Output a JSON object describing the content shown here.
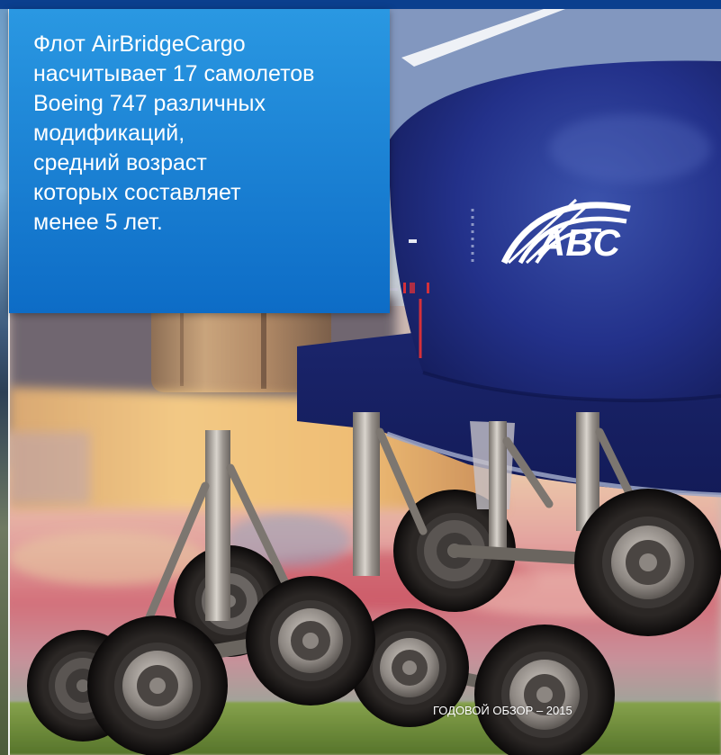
{
  "callout": {
    "lines": [
      "Флот AirBridgeCargo",
      "насчитывает 17 самолетов",
      "Boeing 747 различных",
      "модификаций,",
      "средний возраст",
      "которых составляет",
      "менее 5 лет."
    ]
  },
  "photo": {
    "logo_text": "ABC"
  },
  "footer": {
    "label": "ГОДОВОЙ ОБЗОР – 2015"
  },
  "colors": {
    "top_band": "#0b3f8e",
    "callout_top": "#2a98e2",
    "callout_bottom": "#0d6cc6",
    "aircraft_livery": "#1c2770",
    "text": "#ffffff"
  }
}
